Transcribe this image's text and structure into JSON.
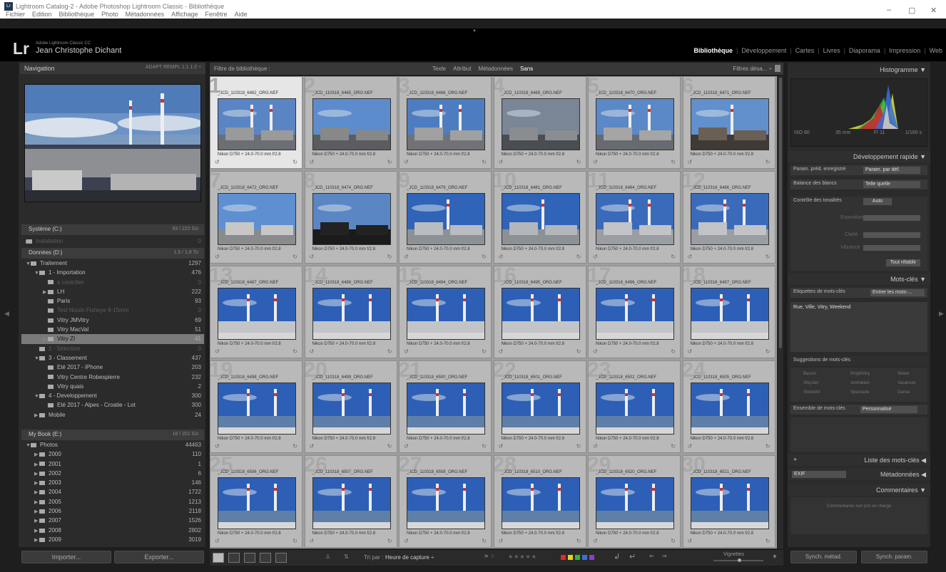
{
  "window": {
    "title": "Lightroom Catalog-2 - Adobe Photoshop Lightroom Classic - Bibliothèque",
    "menus": [
      "Fichier",
      "Edition",
      "Bibliothèque",
      "Photo",
      "Métadonnées",
      "Affichage",
      "Fenêtre",
      "Aide"
    ],
    "controls": {
      "minimize": "–",
      "maximize": "▢",
      "close": "✕"
    },
    "icon_text": "Lr"
  },
  "identity": {
    "logo": "Lr",
    "product": "Adobe Lightroom Classic CC",
    "name": "Jean Christophe Dichant"
  },
  "modules": [
    "Bibliothèque",
    "Développement",
    "Cartes",
    "Livres",
    "Diaporama",
    "Impression",
    "Web"
  ],
  "modules_active": 0,
  "left": {
    "nav_title": "Navigation",
    "nav_options": "ADAPT  REMPL  1:1  1:2 ÷",
    "volumes": [
      {
        "name": "Système (C:)",
        "info": "93 / 222 Go"
      },
      {
        "name": "Données (D:)",
        "info": "1,5 / 1,8 To"
      },
      {
        "name": "My Book (E:)",
        "info": "18 / 201 Go"
      }
    ],
    "tree1": [
      {
        "label": "Traitement",
        "count": "1297",
        "lvl": 1,
        "exp": "▼",
        "dim": false
      },
      {
        "label": "1 - Importation",
        "count": "476",
        "lvl": 2,
        "exp": "▼",
        "dim": false
      },
      {
        "label": "à contrôler",
        "count": "0",
        "lvl": 3,
        "exp": "",
        "dim": true
      },
      {
        "label": "LH",
        "count": "222",
        "lvl": 3,
        "exp": "▶",
        "dim": false
      },
      {
        "label": "Paris",
        "count": "93",
        "lvl": 3,
        "exp": "",
        "dim": false
      },
      {
        "label": "Test Nissin Fisheye 8-15mm",
        "count": "0",
        "lvl": 3,
        "exp": "",
        "dim": true
      },
      {
        "label": "Vitry JMVitry",
        "count": "69",
        "lvl": 3,
        "exp": "",
        "dim": false
      },
      {
        "label": "Vitry MacVal",
        "count": "51",
        "lvl": 3,
        "exp": "",
        "dim": false
      },
      {
        "label": "Vitry ZI",
        "count": "41",
        "lvl": 3,
        "exp": "▷",
        "dim": false,
        "sel": true
      },
      {
        "label": "2 - Sélection",
        "count": "0",
        "lvl": 2,
        "exp": "",
        "dim": true
      },
      {
        "label": "3 - Classement",
        "count": "437",
        "lvl": 2,
        "exp": "▼",
        "dim": false
      },
      {
        "label": "Eté 2017 - iPhone",
        "count": "203",
        "lvl": 3,
        "exp": "",
        "dim": false
      },
      {
        "label": "Vitry Centre Robespierre",
        "count": "232",
        "lvl": 3,
        "exp": "",
        "dim": false
      },
      {
        "label": "Vitry quais",
        "count": "2",
        "lvl": 3,
        "exp": "",
        "dim": false
      },
      {
        "label": "4 - Developpement",
        "count": "300",
        "lvl": 2,
        "exp": "▼",
        "dim": false
      },
      {
        "label": "Eté 2017 - Alpes - Croatie - Lot",
        "count": "300",
        "lvl": 3,
        "exp": "",
        "dim": false
      },
      {
        "label": "Mobile",
        "count": "24",
        "lvl": 2,
        "exp": "▶",
        "dim": false
      }
    ],
    "sys_folder": {
      "label": "Installation",
      "count": "0"
    },
    "tree2": [
      {
        "label": "Photos",
        "count": "44463",
        "lvl": 1,
        "exp": "▼"
      },
      {
        "label": "2000",
        "count": "110",
        "lvl": 2,
        "exp": "▶"
      },
      {
        "label": "2001",
        "count": "1",
        "lvl": 2,
        "exp": "▶"
      },
      {
        "label": "2002",
        "count": "6",
        "lvl": 2,
        "exp": "▶"
      },
      {
        "label": "2003",
        "count": "146",
        "lvl": 2,
        "exp": "▶"
      },
      {
        "label": "2004",
        "count": "1722",
        "lvl": 2,
        "exp": "▶"
      },
      {
        "label": "2005",
        "count": "1213",
        "lvl": 2,
        "exp": "▶"
      },
      {
        "label": "2006",
        "count": "2118",
        "lvl": 2,
        "exp": "▶"
      },
      {
        "label": "2007",
        "count": "1526",
        "lvl": 2,
        "exp": "▶"
      },
      {
        "label": "2008",
        "count": "2802",
        "lvl": 2,
        "exp": "▶"
      },
      {
        "label": "2009",
        "count": "3019",
        "lvl": 2,
        "exp": "▶"
      }
    ],
    "import_btn": "Importer...",
    "export_btn": "Exporter..."
  },
  "filter": {
    "title": "Filtre de bibliothèque :",
    "options": [
      "Texte",
      "Attribut",
      "Métadonnées",
      "Sans"
    ],
    "preset": "Filtres désa... ÷"
  },
  "grid": {
    "camera": "Nikon D750 + 24.0-70.0 mm f/2.8",
    "items": [
      {
        "n": "1",
        "file": "_JCD_110318_6462_ORG.NEF"
      },
      {
        "n": "2",
        "file": "_JCD_110318_6465_ORG.NEF"
      },
      {
        "n": "3",
        "file": "_JCD_110318_6466_ORG.NEF"
      },
      {
        "n": "4",
        "file": "_JCD_110318_6469_ORG.NEF"
      },
      {
        "n": "5",
        "file": "_JCD_110318_6470_ORG.NEF"
      },
      {
        "n": "6",
        "file": "_JCD_110318_6471_ORG.NEF"
      },
      {
        "n": "7",
        "file": "_JCD_110318_6472_ORG.NEF"
      },
      {
        "n": "8",
        "file": "_JCD_110318_6474_ORG.NEF"
      },
      {
        "n": "9",
        "file": "_JCD_110318_6479_ORG.NEF"
      },
      {
        "n": "10",
        "file": "_JCD_110318_6481_ORG.NEF"
      },
      {
        "n": "11",
        "file": "_JCD_110318_6484_ORG.NEF"
      },
      {
        "n": "12",
        "file": "_JCD_110318_6486_ORG.NEF"
      },
      {
        "n": "13",
        "file": "_JCD_110318_6487_ORG.NEF"
      },
      {
        "n": "14",
        "file": "_JCD_110318_6488_ORG.NEF"
      },
      {
        "n": "15",
        "file": "_JCD_110318_6494_ORG.NEF"
      },
      {
        "n": "16",
        "file": "_JCD_110318_6495_ORG.NEF"
      },
      {
        "n": "17",
        "file": "_JCD_110318_6496_ORG.NEF"
      },
      {
        "n": "18",
        "file": "_JCD_110318_6497_ORG.NEF"
      },
      {
        "n": "19",
        "file": "_JCD_110318_6498_ORG.NEF"
      },
      {
        "n": "20",
        "file": "_JCD_110318_6499_ORG.NEF"
      },
      {
        "n": "21",
        "file": "_JCD_110318_6500_ORG.NEF"
      },
      {
        "n": "22",
        "file": "_JCD_110318_6501_ORG.NEF"
      },
      {
        "n": "23",
        "file": "_JCD_110318_6502_ORG.NEF"
      },
      {
        "n": "24",
        "file": "_JCD_110318_6505_ORG.NEF"
      },
      {
        "n": "25",
        "file": "_JCD_110318_6506_ORG.NEF"
      },
      {
        "n": "26",
        "file": "_JCD_110318_6507_ORG.NEF"
      },
      {
        "n": "27",
        "file": "_JCD_110318_6508_ORG.NEF"
      },
      {
        "n": "28",
        "file": "_JCD_110318_6510_ORG.NEF"
      },
      {
        "n": "29",
        "file": "_JCD_110318_6520_ORG.NEF"
      },
      {
        "n": "30",
        "file": "_JCD_110318_6521_ORG.NEF"
      }
    ]
  },
  "toolbar": {
    "sort_label": "Tri par :",
    "sort_value": "Heure de capture ÷",
    "stars": "★★★★★",
    "thumbs_label": "Vignettes",
    "swatches": [
      "#d92c2c",
      "#e6d21e",
      "#2fb53a",
      "#3a6fd8",
      "#8a3fc8"
    ]
  },
  "right": {
    "histogram_title": "Histogramme",
    "histo_info": {
      "iso": "ISO 80",
      "focal": "35 mm",
      "aperture": "F/ 11",
      "shutter": "1/160 s"
    },
    "quickdev_title": "Développement rapide",
    "preset_label": "Param. préd. enregistré",
    "preset_value": "Param. par déf.",
    "wb_label": "Balance des blancs",
    "wb_value": "Telle quelle",
    "tone_label": "Contrôle des tonalités",
    "tone_auto": "Auto",
    "exposure": "Exposition",
    "clarity": "Clarté",
    "vibrance": "Vibrance",
    "reset": "Tout rétablir",
    "keywords_title": "Mots-clés",
    "kw_tags_label": "Etiquettes de mots-clés",
    "kw_tags_value": "Entrer les mots-...",
    "kw_text": "Rue, Ville, Vitry, Weekend",
    "kw_sugg_label": "Suggestions de mots-clés",
    "suggestions": [
      "Bassin",
      "ProjetVitry",
      "Street",
      "VitryJeri",
      "Animation",
      "Vacances",
      "StreetArt",
      "Spectacle",
      "Danse"
    ],
    "kw_set_label": "Ensemble de mots-clés",
    "kw_set_value": "Personnalisé",
    "kwlist_title": "Liste des mots-clés",
    "meta_preset": "EXIF",
    "metadata_title": "Métadonnées",
    "comments_title": "Commentaires",
    "comments_note": "Commentaires non pris en charge",
    "sync_meta": "Synch. métad.",
    "sync_settings": "Synch. param."
  }
}
